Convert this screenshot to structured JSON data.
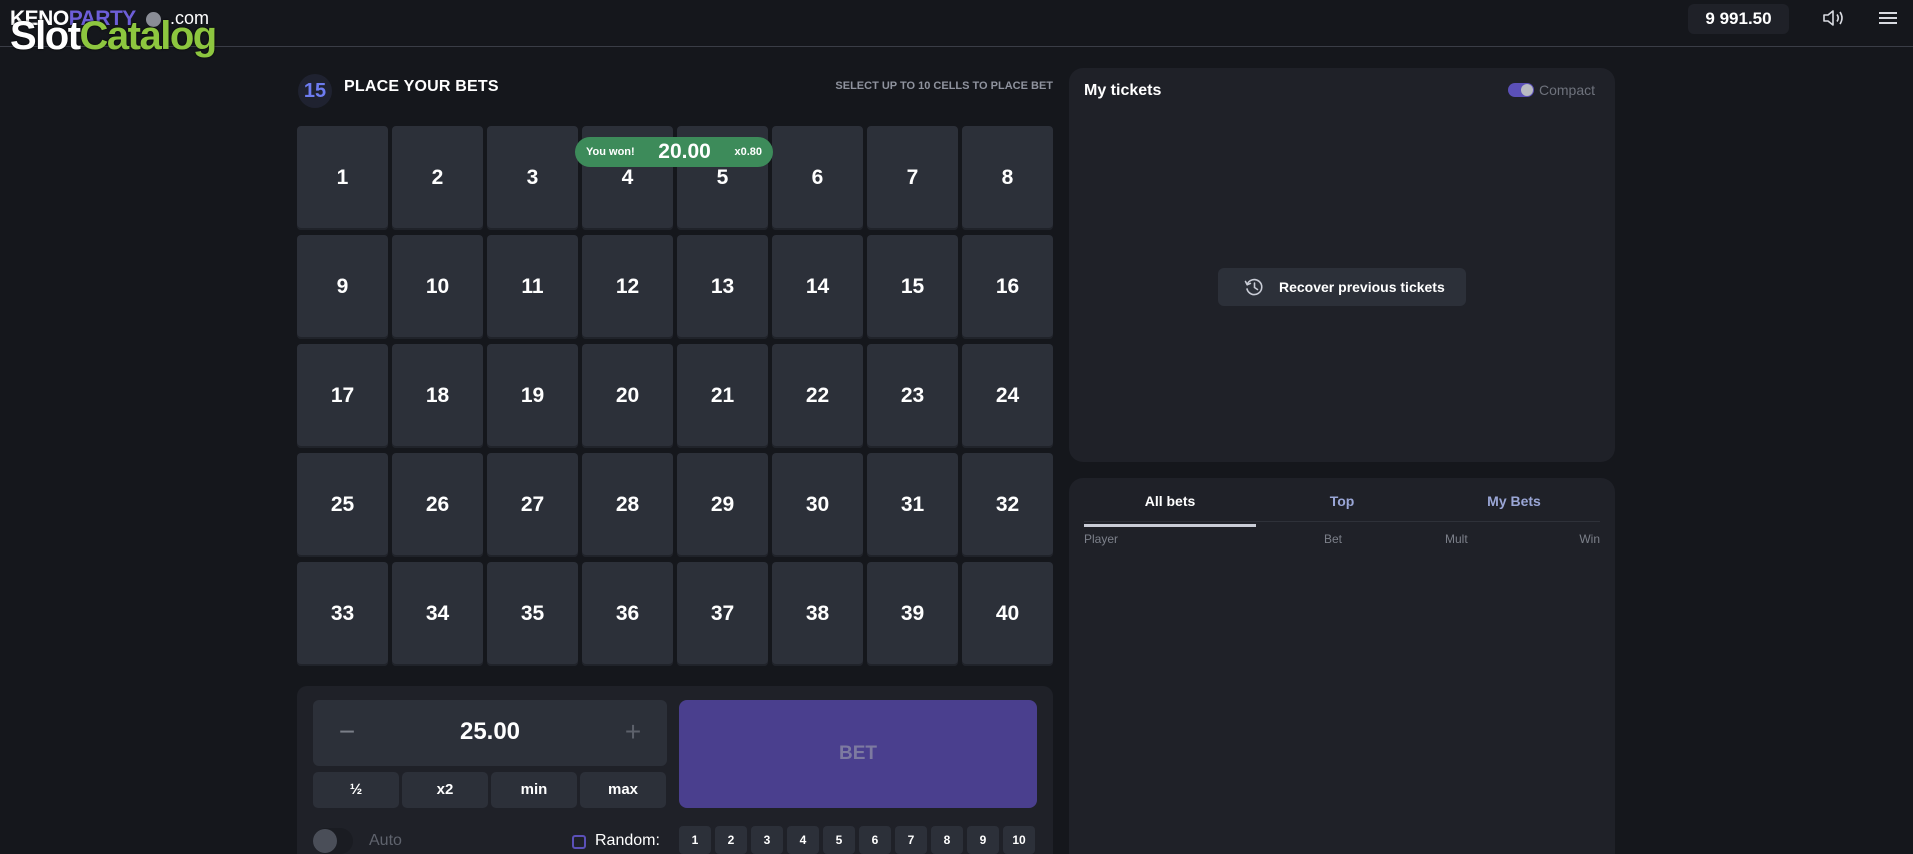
{
  "header": {
    "logo_keno": "KENO",
    "logo_party": "PARTY",
    "logo_dotcom": ".com",
    "logo_slot": "Slot",
    "logo_catalog": "Catalog",
    "balance": "9 991.50"
  },
  "game": {
    "selected_count": "15",
    "title": "PLACE YOUR BETS",
    "hint": "SELECT UP TO 10 CELLS TO PLACE BET",
    "cells": [
      "1",
      "2",
      "3",
      "4",
      "5",
      "6",
      "7",
      "8",
      "9",
      "10",
      "11",
      "12",
      "13",
      "14",
      "15",
      "16",
      "17",
      "18",
      "19",
      "20",
      "21",
      "22",
      "23",
      "24",
      "25",
      "26",
      "27",
      "28",
      "29",
      "30",
      "31",
      "32",
      "33",
      "34",
      "35",
      "36",
      "37",
      "38",
      "39",
      "40"
    ],
    "win_badge": {
      "label": "You won!",
      "amount": "20.00",
      "multiplier": "x0.80"
    }
  },
  "bet_controls": {
    "minus": "−",
    "plus": "+",
    "stake": "25.00",
    "quick": [
      "½",
      "x2",
      "min",
      "max"
    ],
    "bet_label": "BET",
    "auto_label": "Auto",
    "random_label": "Random:",
    "random_options": [
      "1",
      "2",
      "3",
      "4",
      "5",
      "6",
      "7",
      "8",
      "9",
      "10"
    ]
  },
  "tickets": {
    "title": "My tickets",
    "compact_label": "Compact",
    "recover_label": "Recover previous tickets"
  },
  "bets": {
    "tabs": [
      "All bets",
      "Top",
      "My Bets"
    ],
    "columns": [
      "Player",
      "Bet",
      "Mult",
      "Win"
    ]
  },
  "colors": {
    "background": "#15171c",
    "panel": "#1f2128",
    "cell": "#2c3039",
    "win_badge": "#3d8b5a",
    "bet_button": "#4a3f8e",
    "accent": "#5b50b8"
  }
}
